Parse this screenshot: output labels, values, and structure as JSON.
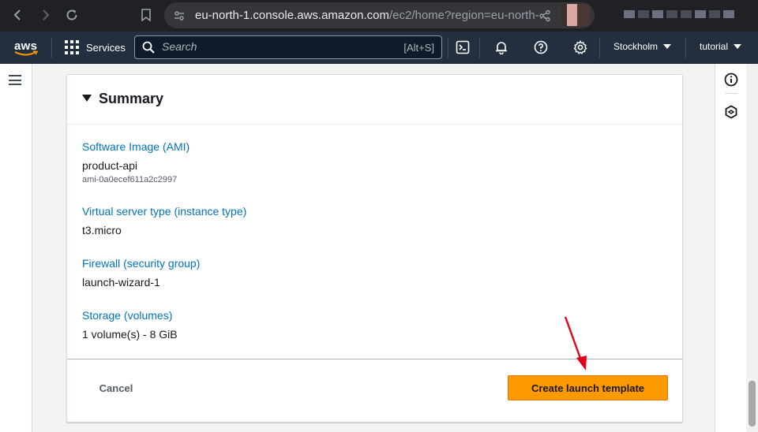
{
  "browser": {
    "url_host": "eu-north-1.console.aws.amazon.com",
    "url_path": "/ec2/home?region=eu-north-…"
  },
  "aws_nav": {
    "logo": "aws",
    "services_label": "Services",
    "search_placeholder": "Search",
    "search_shortcut": "[Alt+S]",
    "region_label": "Stockholm",
    "account_label": "tutorial"
  },
  "summary": {
    "title": "Summary",
    "fields": [
      {
        "label": "Software Image (AMI)",
        "value": "product-api",
        "sub": "ami-0a0ecef611a2c2997"
      },
      {
        "label": "Virtual server type (instance type)",
        "value": "t3.micro"
      },
      {
        "label": "Firewall (security group)",
        "value": "launch-wizard-1"
      },
      {
        "label": "Storage (volumes)",
        "value": "1 volume(s) - 8 GiB"
      }
    ],
    "cancel_label": "Cancel",
    "create_label": "Create launch template"
  },
  "colors": {
    "aws_nav_bg": "#232f3e",
    "primary_button": "#ff9900",
    "link_label": "#0073bb",
    "annotation_arrow": "#e3001b"
  }
}
